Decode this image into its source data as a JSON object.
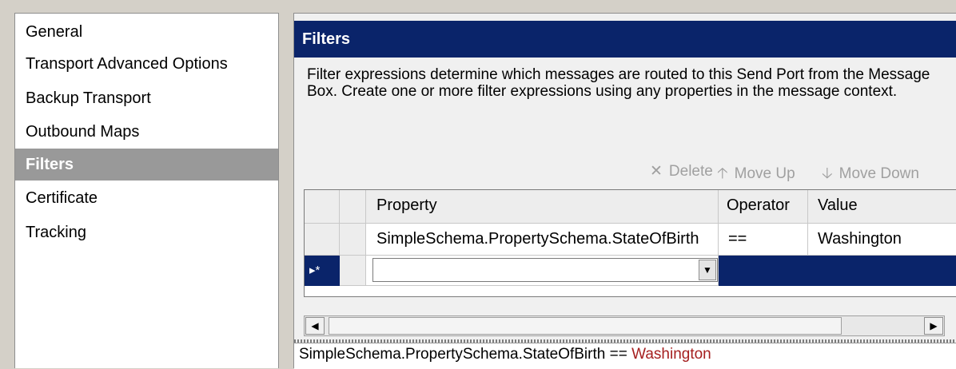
{
  "nav": {
    "items": [
      {
        "label": "General"
      },
      {
        "label": "Transport Advanced Options"
      },
      {
        "label": "Backup Transport"
      },
      {
        "label": "Outbound Maps"
      },
      {
        "label": "Filters"
      },
      {
        "label": "Certificate"
      },
      {
        "label": "Tracking"
      }
    ],
    "selected": "Filters"
  },
  "panel": {
    "title": "Filters",
    "description": "Filter expressions determine which messages are routed to this Send Port from the Message Box. Create one or more filter expressions using any properties in the message context."
  },
  "toolbar": {
    "delete_label": "Delete",
    "delete_icon": "x-icon",
    "move_up_label": "Move Up",
    "move_up_icon": "arrow-up-icon",
    "move_down_label": "Move Down",
    "move_down_icon": "arrow-down-icon"
  },
  "grid": {
    "columns": [
      "Property",
      "Operator",
      "Value"
    ],
    "rows": [
      {
        "property": "SimpleSchema.PropertySchema.StateOfBirth",
        "operator": "==",
        "value": "Washington"
      }
    ],
    "new_row_marker": "▸*",
    "new_row_property": ""
  },
  "expression": {
    "property": "SimpleSchema.PropertySchema.StateOfBirth",
    "operator": "==",
    "value": "Washington"
  },
  "colors": {
    "header_bg": "#0a246a",
    "selected_nav_bg": "#999999",
    "expression_value": "#a51f1f"
  }
}
